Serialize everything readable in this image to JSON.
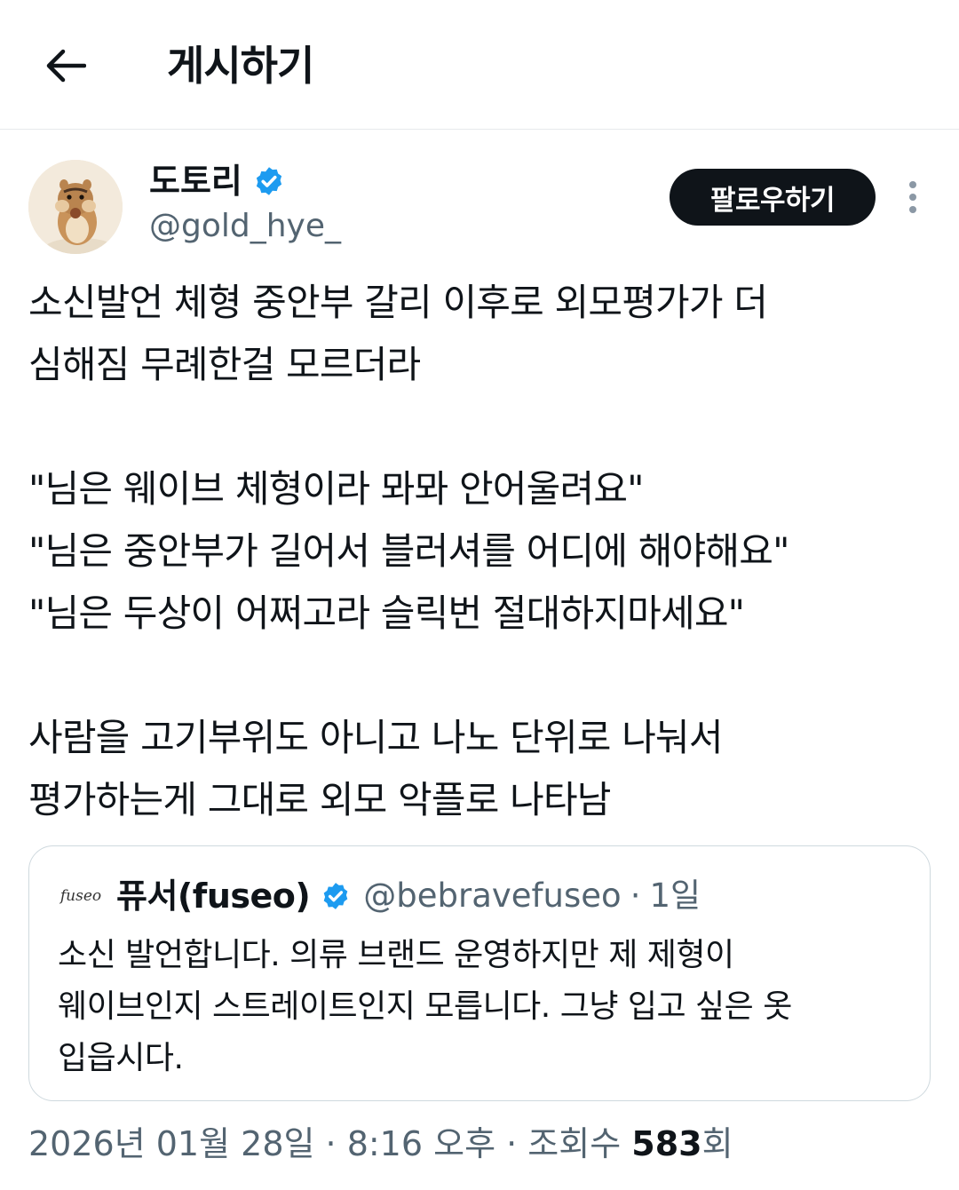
{
  "header": {
    "title": "게시하기"
  },
  "author": {
    "name": "도토리",
    "handle": "@gold_hye_",
    "follow_label": "팔로우하기"
  },
  "tweet": {
    "lines": [
      "소신발언 체형 중안부 갈리 이후로 외모평가가 더",
      "심해짐 무례한걸 모르더라",
      "",
      "\"님은 웨이브 체형이라 뫄뫄 안어울려요\"",
      "\"님은 중안부가 길어서 블러셔를 어디에 해야해요\"",
      "\"님은 두상이 어쩌고라 슬릭번 절대하지마세요\"",
      "",
      "사람을 고기부위도 아니고 나노 단위로 나눠서",
      "평가하는게 그대로 외모 악플로 나타남"
    ]
  },
  "quote": {
    "avatar_text": "fuseo",
    "name": "퓨서(fuseo)",
    "handle": "@bebravefuseo",
    "dot": "·",
    "time": "1일",
    "lines": [
      "소신 발언합니다. 의류 브랜드 운영하지만 제 제형이",
      "웨이브인지 스트레이트인지 모릅니다. 그냥 입고 싶은 옷",
      "입읍시다."
    ]
  },
  "meta": {
    "date": "2026년 01월 28일",
    "sep1": " · ",
    "time": "8:16 오후",
    "sep2": " · ",
    "views_label": "조회수 ",
    "views_count": "583",
    "views_suffix": "회"
  },
  "colors": {
    "text": "#0f1419",
    "secondary": "#536471",
    "verified": "#1d9bf0",
    "border": "#cfd9de"
  },
  "icons": {
    "back": "arrow-left-icon",
    "verified": "verified-badge-icon",
    "more": "more-vertical-icon"
  }
}
